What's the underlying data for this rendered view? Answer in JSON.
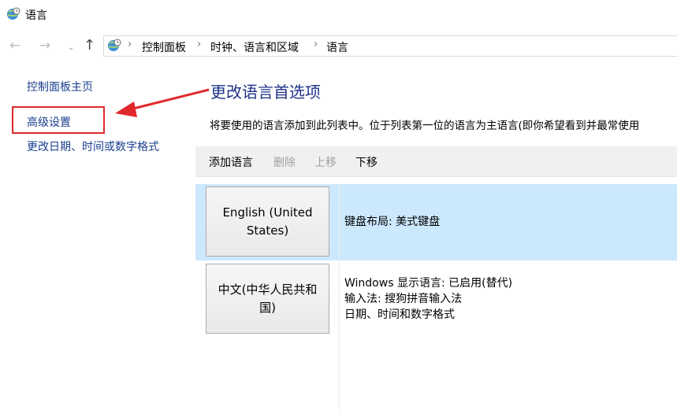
{
  "window": {
    "title": "语言"
  },
  "nav": {
    "back_glyph": "←",
    "forward_glyph": "→",
    "recent_glyph": "⌄",
    "up_glyph": "↑"
  },
  "breadcrumb": {
    "items": [
      "控制面板",
      "时钟、语言和区域",
      "语言"
    ],
    "separator": "›"
  },
  "sidebar": {
    "items": [
      {
        "label": "控制面板主页"
      },
      {
        "label": "高级设置"
      },
      {
        "label": "更改日期、时间或数字格式"
      }
    ]
  },
  "main": {
    "heading": "更改语言首选项",
    "description": "将要使用的语言添加到此列表中。位于列表第一位的语言为主语言(即你希望看到并最常使用"
  },
  "toolbar": {
    "add_label": "添加语言",
    "remove_label": "删除",
    "up_label": "上移",
    "down_label": "下移"
  },
  "languages": [
    {
      "name": "English (United States)",
      "details": [
        "键盘布局: 美式键盘"
      ],
      "selected": true
    },
    {
      "name": "中文(中华人民共和国)",
      "details": [
        "Windows 显示语言: 已启用(替代)",
        "输入法: 搜狗拼音输入法",
        "日期、时间和数字格式"
      ],
      "selected": false
    }
  ],
  "colors": {
    "link": "#1a3f8f",
    "heading": "#1e3287",
    "selection": "#cce8fd",
    "annotation": "#e0282c"
  },
  "icons": {
    "app": "globe-clock-icon",
    "address": "globe-clock-icon"
  }
}
